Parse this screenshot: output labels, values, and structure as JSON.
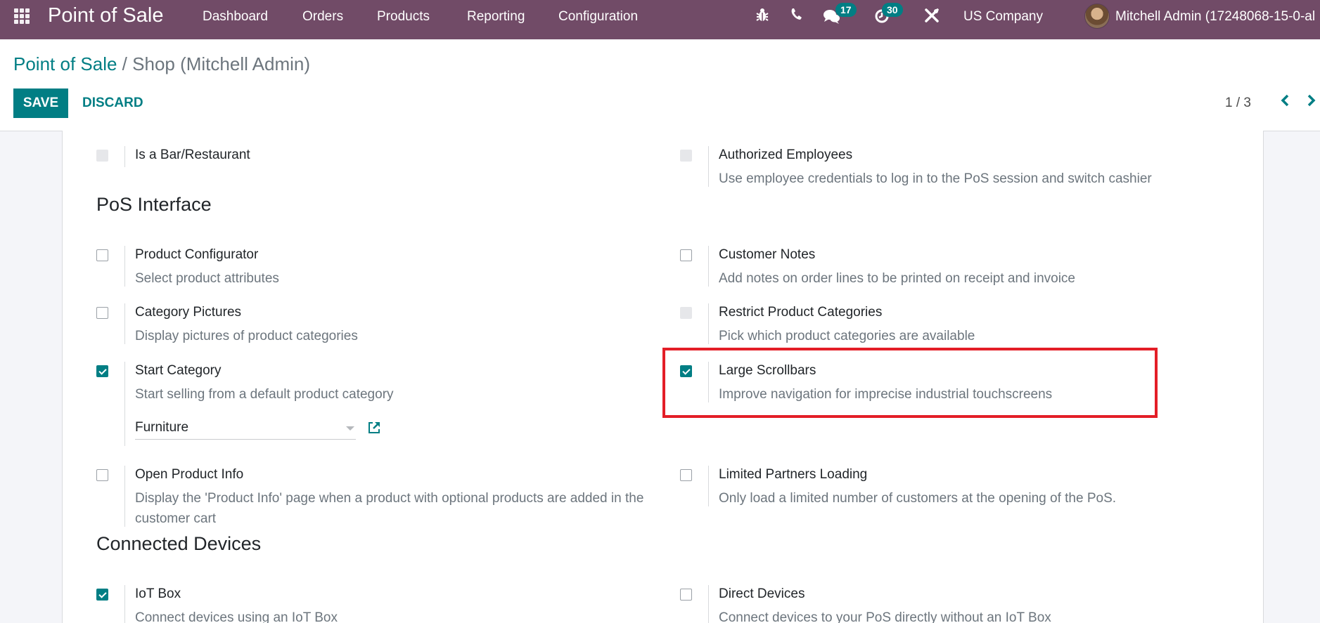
{
  "navbar": {
    "app_name": "Point of Sale",
    "menu": [
      "Dashboard",
      "Orders",
      "Products",
      "Reporting",
      "Configuration"
    ],
    "messages_count": "17",
    "activities_count": "30",
    "company": "US Company",
    "user": "Mitchell Admin (17248068-15-0-al",
    "colors": {
      "navbar_bg": "#714B67",
      "accent": "#017E84"
    }
  },
  "breadcrumb": {
    "parent": "Point of Sale",
    "separator": "/",
    "current": "Shop (Mitchell Admin)"
  },
  "toolbar": {
    "save_label": "SAVE",
    "discard_label": "DISCARD"
  },
  "pager": {
    "value": "1 / 3"
  },
  "sections": {
    "pos_interface": "PoS Interface",
    "connected_devices": "Connected Devices"
  },
  "settings": {
    "bar_restaurant": {
      "title": "Is a Bar/Restaurant",
      "state": "disabled"
    },
    "authorized_employees": {
      "title": "Authorized Employees",
      "desc": "Use employee credentials to log in to the PoS session and switch cashier",
      "state": "disabled"
    },
    "product_configurator": {
      "title": "Product Configurator",
      "desc": "Select product attributes",
      "state": "unchecked"
    },
    "customer_notes": {
      "title": "Customer Notes",
      "desc": "Add notes on order lines to be printed on receipt and invoice",
      "state": "unchecked"
    },
    "category_pictures": {
      "title": "Category Pictures",
      "desc": "Display pictures of product categories",
      "state": "unchecked"
    },
    "restrict_categories": {
      "title": "Restrict Product Categories",
      "desc": "Pick which product categories are available",
      "state": "disabled"
    },
    "start_category": {
      "title": "Start Category",
      "desc": "Start selling from a default product category",
      "state": "checked",
      "value": "Furniture"
    },
    "large_scrollbars": {
      "title": "Large Scrollbars",
      "desc": "Improve navigation for imprecise industrial touchscreens",
      "state": "checked"
    },
    "open_product_info": {
      "title": "Open Product Info",
      "desc": "Display the 'Product Info' page when a product with optional products are added in the customer cart",
      "state": "unchecked"
    },
    "limited_partners": {
      "title": "Limited Partners Loading",
      "desc": "Only load a limited number of customers at the opening of the PoS.",
      "state": "unchecked"
    },
    "iot_box": {
      "title": "IoT Box",
      "desc": "Connect devices using an IoT Box",
      "state": "checked"
    },
    "direct_devices": {
      "title": "Direct Devices",
      "desc": "Connect devices to your PoS directly without an IoT Box",
      "state": "unchecked"
    }
  }
}
